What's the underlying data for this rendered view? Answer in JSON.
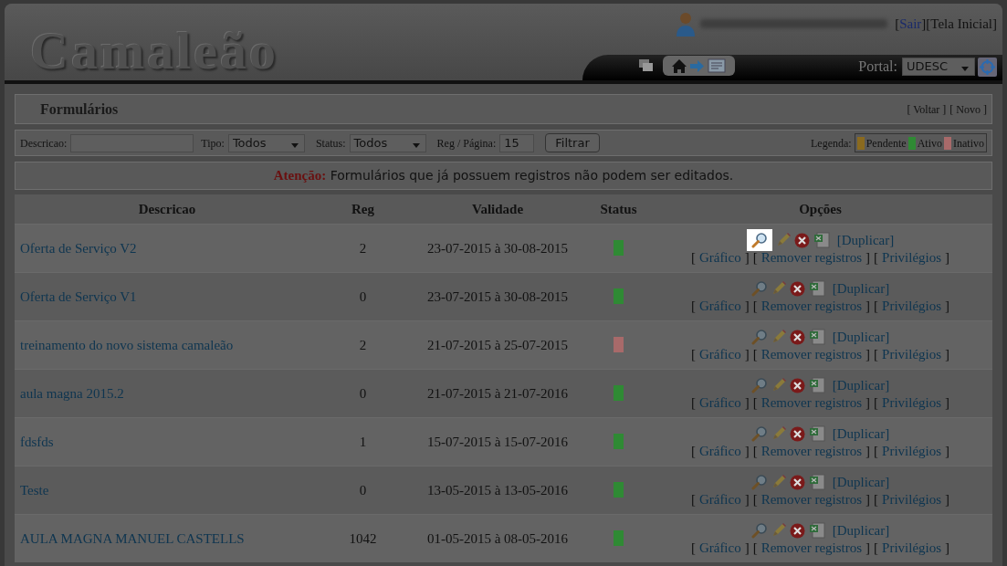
{
  "header": {
    "logo": "Camaleão",
    "nav": [
      {
        "kind": "bracket",
        "text": "["
      },
      {
        "kind": "link",
        "text": "Sair"
      },
      {
        "kind": "bracket",
        "text": "]["
      },
      {
        "kind": "plain",
        "text": "Tela Inicial"
      },
      {
        "kind": "bracket",
        "text": "]"
      }
    ],
    "portal": {
      "label": "Portal:",
      "value": "UDESC"
    }
  },
  "panel": {
    "title": "Formulários",
    "links": [
      "[ Voltar ]",
      "[ Novo ]"
    ]
  },
  "filters": {
    "description": {
      "label": "Descricao:"
    },
    "type": {
      "label": "Tipo:",
      "value": "Todos"
    },
    "status": {
      "label": "Status:",
      "value": "Todos"
    },
    "per_page": {
      "label": "Reg / Página:",
      "value": "15"
    },
    "button": "Filtrar",
    "legend": {
      "label": "Legenda:",
      "items": [
        {
          "text": "Pendente",
          "color": "#8a6a1f"
        },
        {
          "text": "Ativo",
          "color": "#2f8a34"
        },
        {
          "text": "Inativo",
          "color": "#a86a6a"
        }
      ]
    }
  },
  "notice": {
    "title": "Atenção:",
    "text": "Formulários que já possuem registros não podem ser editados."
  },
  "table": {
    "columns": [
      "Descricao",
      "Reg",
      "Validade",
      "Status",
      "Opções"
    ],
    "rows": [
      {
        "description": "Oferta de Serviço V2",
        "reg": "2",
        "validity": "23-07-2015 à 30-08-2015",
        "color": "#2f8a34",
        "view_highlighted": true,
        "duplicate": "[Duplicar]",
        "links": [
          {
            "open": "[",
            "text": "Gráfico",
            "close": "]"
          },
          {
            "open": "[",
            "text": "Remover registros",
            "close": "]"
          },
          {
            "open": "[",
            "text": "Privilégios",
            "close": "]"
          }
        ]
      },
      {
        "description": "Oferta de Serviço V1",
        "reg": "0",
        "validity": "23-07-2015 à 30-08-2015",
        "color": "#2f8a34",
        "view_highlighted": false,
        "duplicate": "[Duplicar]",
        "links": [
          {
            "open": "[",
            "text": "Gráfico",
            "close": "]"
          },
          {
            "open": "[",
            "text": "Remover registros",
            "close": "]"
          },
          {
            "open": "[",
            "text": "Privilégios",
            "close": "]"
          }
        ]
      },
      {
        "description": "treinamento do novo sistema camaleão",
        "reg": "2",
        "validity": "21-07-2015 à 25-07-2015",
        "color": "#a86a6a",
        "view_highlighted": false,
        "duplicate": "[Duplicar]",
        "links": [
          {
            "open": "[",
            "text": "Gráfico",
            "close": "]"
          },
          {
            "open": "[",
            "text": "Remover registros",
            "close": "]"
          },
          {
            "open": "[",
            "text": "Privilégios",
            "close": "]"
          }
        ]
      },
      {
        "description": "aula magna 2015.2",
        "reg": "0",
        "validity": "21-07-2015 à 21-07-2016",
        "color": "#2f8a34",
        "view_highlighted": false,
        "duplicate": "[Duplicar]",
        "links": [
          {
            "open": "[",
            "text": "Gráfico",
            "close": "]"
          },
          {
            "open": "[",
            "text": "Remover registros",
            "close": "]"
          },
          {
            "open": "[",
            "text": "Privilégios",
            "close": "]"
          }
        ]
      },
      {
        "description": "fdsfds",
        "reg": "1",
        "validity": "15-07-2015 à 15-07-2016",
        "color": "#2f8a34",
        "view_highlighted": false,
        "duplicate": "[Duplicar]",
        "links": [
          {
            "open": "[",
            "text": "Gráfico",
            "close": "]"
          },
          {
            "open": "[",
            "text": "Remover registros",
            "close": "]"
          },
          {
            "open": "[",
            "text": "Privilégios",
            "close": "]"
          }
        ]
      },
      {
        "description": "Teste",
        "reg": "0",
        "validity": "13-05-2015 à 13-05-2016",
        "color": "#2f8a34",
        "view_highlighted": false,
        "duplicate": "[Duplicar]",
        "links": [
          {
            "open": "[",
            "text": "Gráfico",
            "close": "]"
          },
          {
            "open": "[",
            "text": "Remover registros",
            "close": "]"
          },
          {
            "open": "[",
            "text": "Privilégios",
            "close": "]"
          }
        ]
      },
      {
        "description": "AULA MAGNA MANUEL CASTELLS",
        "reg": "1042",
        "validity": "01-05-2015 à 08-05-2016",
        "color": "#2f8a34",
        "view_highlighted": false,
        "duplicate": "[Duplicar]",
        "links": [
          {
            "open": "[",
            "text": "Gráfico",
            "close": "]"
          },
          {
            "open": "[",
            "text": "Remover registros",
            "close": "]"
          },
          {
            "open": "[",
            "text": "Privilégios",
            "close": "]"
          }
        ]
      }
    ]
  }
}
